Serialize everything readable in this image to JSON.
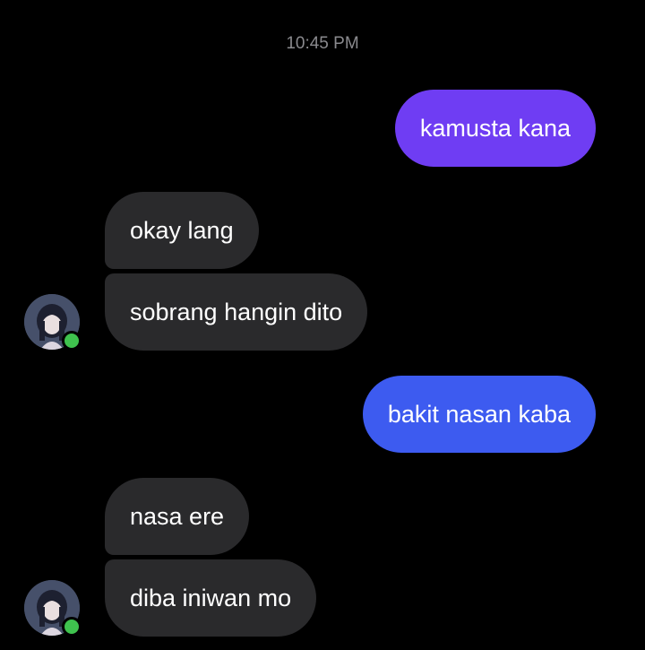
{
  "conversation": {
    "timestamp": "10:45 PM",
    "messages": [
      {
        "sender": "me",
        "text": "kamusta kana",
        "color": "#6f3df3"
      },
      {
        "sender": "contact",
        "text": "okay lang"
      },
      {
        "sender": "contact",
        "text": "sobrang hangin dito"
      },
      {
        "sender": "me",
        "text": "bakit nasan kaba",
        "color": "#3d5bf0"
      },
      {
        "sender": "contact",
        "text": "nasa ere"
      },
      {
        "sender": "contact",
        "text": "diba iniwan mo"
      }
    ]
  },
  "contact": {
    "avatar_icon": "contact-avatar",
    "status": "online",
    "status_color": "#3fc24e"
  },
  "theme": {
    "background": "#000000",
    "incoming_bubble": "#2a2a2c",
    "timestamp_color": "#8a8a8e"
  }
}
